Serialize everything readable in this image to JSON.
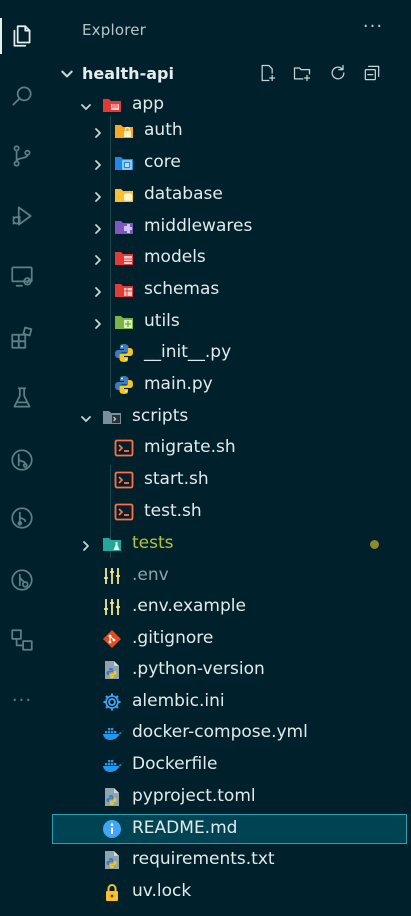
{
  "activity_bar": {
    "items": [
      {
        "name": "explorer-icon",
        "active": true
      },
      {
        "name": "search-icon",
        "active": false
      },
      {
        "name": "source-control-icon",
        "active": false
      },
      {
        "name": "run-debug-icon",
        "active": false
      },
      {
        "name": "remote-explorer-icon",
        "active": false
      },
      {
        "name": "extensions-icon",
        "active": false
      },
      {
        "name": "testing-icon",
        "active": false
      },
      {
        "name": "gitlens-icon",
        "active": false
      },
      {
        "name": "git-graph-icon",
        "active": false
      },
      {
        "name": "pull-requests-icon",
        "active": false
      },
      {
        "name": "workspaces-icon",
        "active": false
      }
    ],
    "more_label": "···"
  },
  "sidebar": {
    "title": "Explorer",
    "more_label": "···",
    "project": {
      "name": "health-api",
      "actions": [
        "new-file-icon",
        "new-folder-icon",
        "refresh-icon",
        "collapse-all-icon"
      ]
    }
  },
  "tree": [
    {
      "label": "app",
      "kind": "folder",
      "icon": "folder-app-icon",
      "expanded": true,
      "depth": 1
    },
    {
      "label": "auth",
      "kind": "folder",
      "icon": "folder-auth-icon",
      "expanded": false,
      "depth": 2
    },
    {
      "label": "core",
      "kind": "folder",
      "icon": "folder-core-icon",
      "expanded": false,
      "depth": 2
    },
    {
      "label": "database",
      "kind": "folder",
      "icon": "folder-database-icon",
      "expanded": false,
      "depth": 2
    },
    {
      "label": "middlewares",
      "kind": "folder",
      "icon": "folder-middleware-icon",
      "expanded": false,
      "depth": 2
    },
    {
      "label": "models",
      "kind": "folder",
      "icon": "folder-models-icon",
      "expanded": false,
      "depth": 2
    },
    {
      "label": "schemas",
      "kind": "folder",
      "icon": "folder-schemas-icon",
      "expanded": false,
      "depth": 2
    },
    {
      "label": "utils",
      "kind": "folder",
      "icon": "folder-utils-icon",
      "expanded": false,
      "depth": 2
    },
    {
      "label": "__init__.py",
      "kind": "file",
      "icon": "python-icon",
      "depth": 2
    },
    {
      "label": "main.py",
      "kind": "file",
      "icon": "python-icon",
      "depth": 2
    },
    {
      "label": "scripts",
      "kind": "folder",
      "icon": "folder-scripts-icon",
      "expanded": true,
      "depth": 1
    },
    {
      "label": "migrate.sh",
      "kind": "file",
      "icon": "shell-icon",
      "depth": 2
    },
    {
      "label": "start.sh",
      "kind": "file",
      "icon": "shell-icon",
      "depth": 2
    },
    {
      "label": "test.sh",
      "kind": "file",
      "icon": "shell-icon",
      "depth": 2
    },
    {
      "label": "tests",
      "kind": "folder",
      "icon": "folder-tests-icon",
      "expanded": false,
      "depth": 1,
      "git_status": "untracked"
    },
    {
      "label": ".env",
      "kind": "file",
      "icon": "env-icon",
      "depth": 1,
      "dim": true
    },
    {
      "label": ".env.example",
      "kind": "file",
      "icon": "env-icon",
      "depth": 1
    },
    {
      "label": ".gitignore",
      "kind": "file",
      "icon": "git-icon",
      "depth": 1
    },
    {
      "label": ".python-version",
      "kind": "file",
      "icon": "python-file-icon",
      "depth": 1
    },
    {
      "label": "alembic.ini",
      "kind": "file",
      "icon": "settings-gear-icon",
      "depth": 1
    },
    {
      "label": "docker-compose.yml",
      "kind": "file",
      "icon": "docker-icon",
      "depth": 1
    },
    {
      "label": "Dockerfile",
      "kind": "file",
      "icon": "docker-icon",
      "depth": 1
    },
    {
      "label": "pyproject.toml",
      "kind": "file",
      "icon": "python-file-icon",
      "depth": 1
    },
    {
      "label": "README.md",
      "kind": "file",
      "icon": "info-icon",
      "depth": 1,
      "selected": true
    },
    {
      "label": "requirements.txt",
      "kind": "file",
      "icon": "python-file-icon",
      "depth": 1
    },
    {
      "label": "uv.lock",
      "kind": "file",
      "icon": "lock-icon",
      "depth": 1
    }
  ],
  "colors": {
    "background": "#00212b",
    "selection": "#004454",
    "selection_border": "#2aa1b3",
    "untracked": "#b6c23a"
  }
}
